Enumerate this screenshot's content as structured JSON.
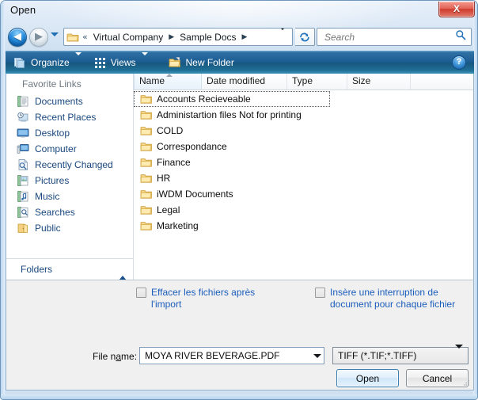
{
  "window": {
    "title": "Open",
    "close_glyph": "X",
    "close_icon": "close-icon"
  },
  "nav": {
    "back_glyph": "◀",
    "forward_glyph": "▶",
    "history_icon": "chevron-down-icon",
    "refresh_icon": "refresh-icon",
    "address": {
      "leading_chevrons": "«",
      "crumbs": [
        {
          "label": "Virtual Company",
          "sep": "▶"
        },
        {
          "label": "Sample Docs",
          "sep": "▶"
        }
      ],
      "dropdown_icon": "chevron-down-icon",
      "folder_icon": "folder-icon"
    },
    "search": {
      "placeholder": "Search",
      "value": "",
      "icon": "search-icon"
    }
  },
  "toolbar": {
    "organize_label": "Organize",
    "organize_icon": "pages-stack-icon",
    "views_label": "Views",
    "views_icon": "grid-view-icon",
    "new_folder_label": "New Folder",
    "new_folder_icon": "new-folder-icon",
    "help_glyph": "?",
    "help_icon": "help-icon"
  },
  "sidebar": {
    "header": "Favorite Links",
    "items": [
      {
        "label": "Documents",
        "icon": "documents-icon"
      },
      {
        "label": "Recent Places",
        "icon": "recent-places-icon"
      },
      {
        "label": "Desktop",
        "icon": "desktop-icon"
      },
      {
        "label": "Computer",
        "icon": "computer-icon"
      },
      {
        "label": "Recently Changed",
        "icon": "recently-changed-icon"
      },
      {
        "label": "Pictures",
        "icon": "pictures-icon"
      },
      {
        "label": "Music",
        "icon": "music-icon"
      },
      {
        "label": "Searches",
        "icon": "searches-icon"
      },
      {
        "label": "Public",
        "icon": "public-folder-icon"
      }
    ],
    "folders_label": "Folders",
    "folders_chevron_icon": "chevron-up-icon"
  },
  "filelist": {
    "columns": [
      {
        "label": "Name",
        "sorted": true
      },
      {
        "label": "Date modified",
        "sorted": false
      },
      {
        "label": "Type",
        "sorted": false
      },
      {
        "label": "Size",
        "sorted": false
      },
      {
        "label": "",
        "sorted": false
      }
    ],
    "rows": [
      {
        "name": "Accounts Recieveable",
        "icon": "folder-icon",
        "focused": true
      },
      {
        "name": "Administartion files Not for printing",
        "icon": "folder-icon",
        "focused": false
      },
      {
        "name": "COLD",
        "icon": "folder-icon",
        "focused": false
      },
      {
        "name": "Correspondance",
        "icon": "folder-icon",
        "focused": false
      },
      {
        "name": "Finance",
        "icon": "folder-icon",
        "focused": false
      },
      {
        "name": "HR",
        "icon": "folder-icon",
        "focused": false
      },
      {
        "name": "iWDM Documents",
        "icon": "folder-icon",
        "focused": false
      },
      {
        "name": "Legal",
        "icon": "folder-icon",
        "focused": false
      },
      {
        "name": "Marketing",
        "icon": "folder-icon",
        "focused": false
      }
    ]
  },
  "options": {
    "effacer_label": "Effacer les fichiers après l'import",
    "effacer_checked": false,
    "insere_label": "Insère une interruption de document pour chaque fichier",
    "insere_checked": false
  },
  "footer": {
    "filename_label": "File name:",
    "filename_value": "MOYA RIVER BEVERAGE.PDF",
    "filename_dropdown_icon": "chevron-down-icon",
    "filetype_value": "TIFF (*.TIF;*.TIFF)",
    "filetype_dropdown_icon": "chevron-down-icon",
    "open_label": "Open",
    "cancel_label": "Cancel",
    "resize_grip_icon": "resize-grip-icon"
  },
  "colors": {
    "accent_blue": "#1b5d92",
    "link_blue": "#19477e",
    "option_blue": "#1c5dbc",
    "close_red": "#cf3c2d",
    "folder_yellow": "#fcd777"
  }
}
